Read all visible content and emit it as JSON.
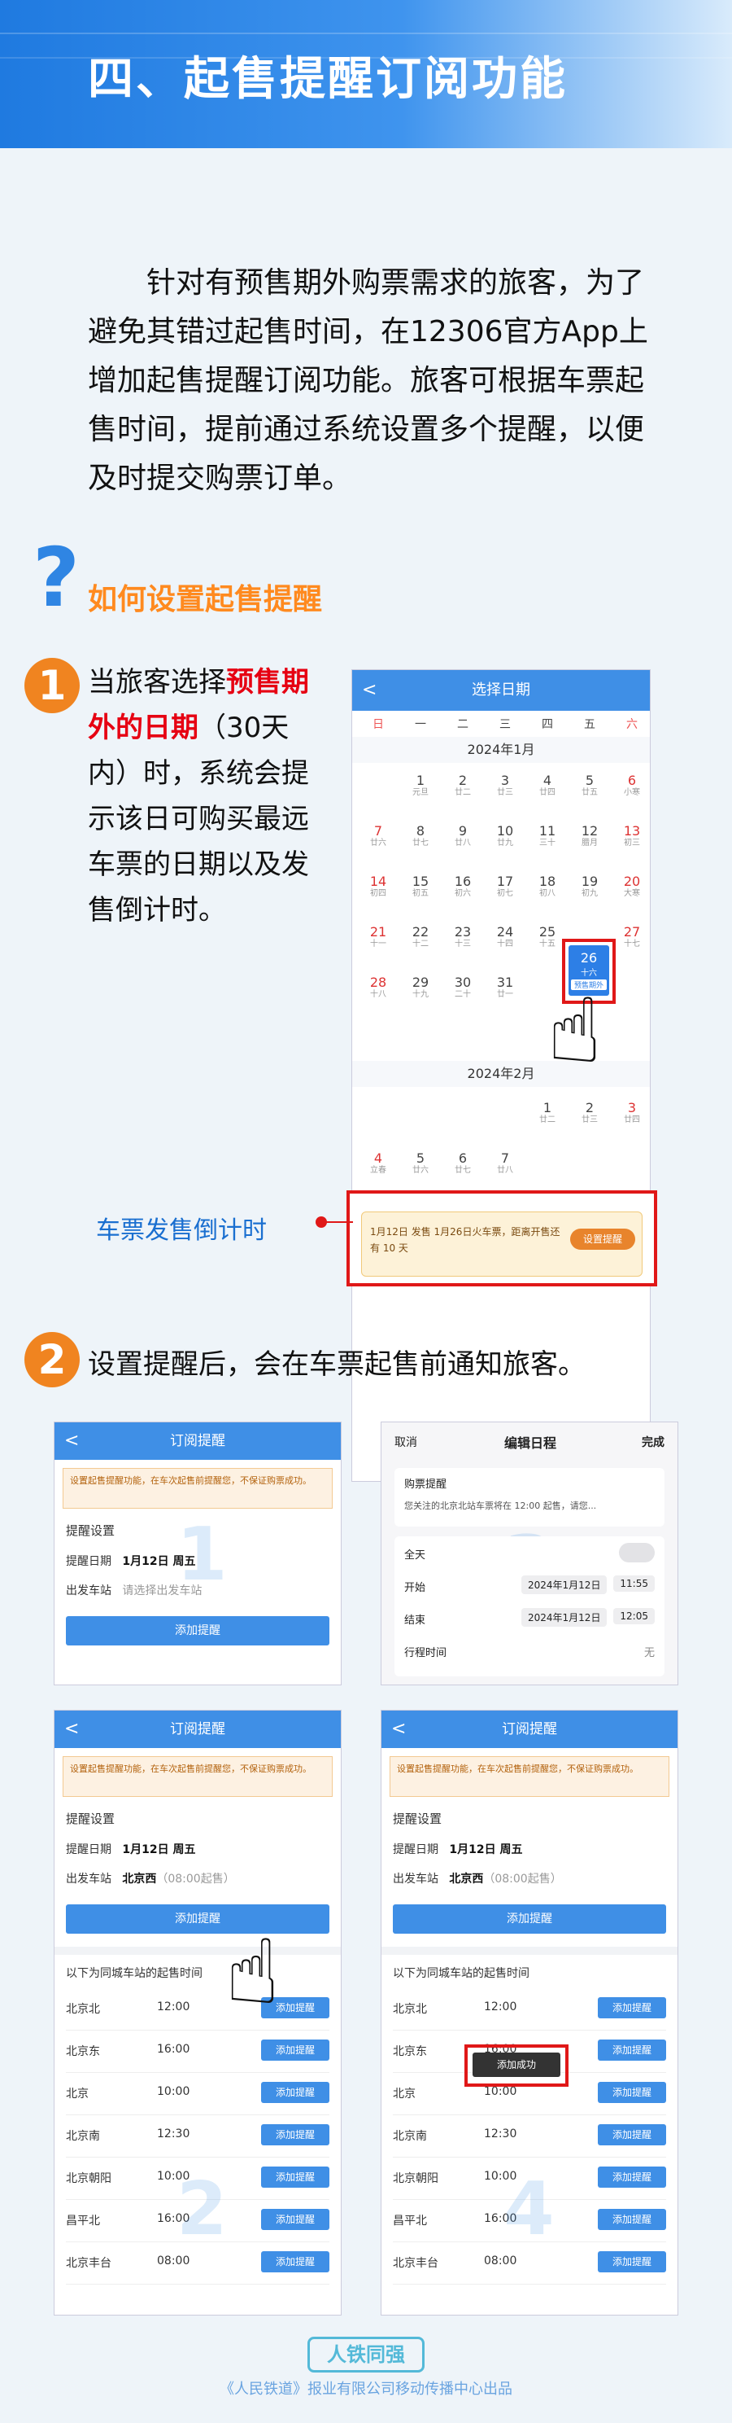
{
  "header": {
    "title": "四、起售提醒订阅功能"
  },
  "intro": {
    "text": "针对有预售期外购票需求的旅客，为了避免其错过起售时间，在12306官方App上增加起售提醒订阅功能。旅客可根据车票起售时间，提前通过系统设置多个提醒，以便及时提交购票订单。"
  },
  "question": {
    "mark": "?",
    "title": "如何设置起售提醒"
  },
  "step1": {
    "num": "1",
    "t1": "当旅客选择",
    "t2": "预售期外的日期",
    "t3": "（30天内）时，系统会提示该日可购买最远车票的日期以及发售倒计时。",
    "countdown_label": "车票发售倒计时"
  },
  "step2": {
    "num": "2",
    "text": "设置提醒后，会在车票起售前通知旅客。"
  },
  "phone1": {
    "title": "选择日期",
    "back": "<",
    "weekdays": [
      "日",
      "一",
      "二",
      "三",
      "四",
      "五",
      "六"
    ],
    "month1": "2024年1月",
    "month2": "2024年2月",
    "days1": [
      [
        "",
        "",
        ""
      ],
      [
        "1",
        "元旦",
        ""
      ],
      [
        "2",
        "廿二",
        ""
      ],
      [
        "3",
        "廿三",
        ""
      ],
      [
        "4",
        "廿四",
        ""
      ],
      [
        "5",
        "廿五",
        ""
      ],
      [
        "6",
        "小寒",
        ""
      ],
      [
        "7",
        "廿六",
        ""
      ],
      [
        "8",
        "廿七",
        ""
      ],
      [
        "9",
        "廿八",
        ""
      ],
      [
        "10",
        "廿九",
        ""
      ],
      [
        "11",
        "三十",
        ""
      ],
      [
        "12",
        "腊月",
        ""
      ],
      [
        "13",
        "初三",
        ""
      ],
      [
        "14",
        "初四",
        ""
      ],
      [
        "15",
        "初五",
        ""
      ],
      [
        "16",
        "初六",
        ""
      ],
      [
        "17",
        "初七",
        ""
      ],
      [
        "18",
        "初八",
        ""
      ],
      [
        "19",
        "初九",
        ""
      ],
      [
        "20",
        "大寒",
        ""
      ],
      [
        "21",
        "十一",
        ""
      ],
      [
        "22",
        "十二",
        ""
      ],
      [
        "23",
        "十三",
        ""
      ],
      [
        "24",
        "十四",
        ""
      ],
      [
        "25",
        "十五",
        ""
      ],
      [
        "26",
        "十六",
        ""
      ],
      [
        "27",
        "十七",
        ""
      ],
      [
        "28",
        "十八",
        ""
      ],
      [
        "29",
        "十九",
        ""
      ],
      [
        "30",
        "二十",
        ""
      ],
      [
        "31",
        "廿一",
        ""
      ]
    ],
    "sel_day": "26",
    "sel_sub": "十六",
    "sel_tag": "预售期外",
    "days2": [
      [
        "1",
        "廿二"
      ],
      [
        "2",
        "廿三"
      ],
      [
        "3",
        "廿四"
      ],
      [
        "4",
        "立春"
      ],
      [
        "5",
        "廿六"
      ],
      [
        "6",
        "廿七"
      ],
      [
        "7",
        "廿八"
      ]
    ],
    "banner_text": "1月12日 发售 1月26日火车票，距离开售还有 10 天",
    "banner_btn": "设置提醒"
  },
  "phoneA": {
    "title": "订阅提醒",
    "back": "<",
    "notice": "设置起售提醒功能，在车次起售前提醒您，不保证购票成功。",
    "num": "1",
    "section": "提醒设置",
    "r1_label": "提醒日期",
    "r1_val": "1月12日 周五",
    "r2_label": "出发车站",
    "r2_val": "请选择出发车站",
    "btn": "添加提醒"
  },
  "phoneB": {
    "cancel": "取消",
    "title": "编辑日程",
    "done": "完成",
    "num": "3",
    "item": "购票提醒",
    "desc": "您关注的北京北站车票将在 12:00 起售，请您...",
    "allday": "全天",
    "start": "开始",
    "start_date": "2024年1月12日",
    "start_time": "11:55",
    "end": "结束",
    "end_date": "2024年1月12日",
    "end_time": "12:05",
    "travel": "行程时间",
    "travel_val": "无"
  },
  "phoneC": {
    "title": "订阅提醒",
    "back": "<",
    "notice": "设置起售提醒功能，在车次起售前提醒您，不保证购票成功。",
    "num": "2",
    "section": "提醒设置",
    "r1_label": "提醒日期",
    "r1_val": "1月12日 周五",
    "r2_label": "出发车站",
    "r2_val": "北京西",
    "r2_sub": "（08:00起售）",
    "btn": "添加提醒",
    "list_title": "以下为同城车站的起售时间",
    "stations": [
      [
        "北京北",
        "12:00"
      ],
      [
        "北京东",
        "16:00"
      ],
      [
        "北京",
        "10:00"
      ],
      [
        "北京南",
        "12:30"
      ],
      [
        "北京朝阳",
        "10:00"
      ],
      [
        "昌平北",
        "16:00"
      ],
      [
        "北京丰台",
        "08:00"
      ]
    ],
    "add": "添加提醒"
  },
  "phoneD": {
    "title": "订阅提醒",
    "back": "<",
    "notice": "设置起售提醒功能，在车次起售前提醒您，不保证购票成功。",
    "num": "4",
    "section": "提醒设置",
    "r1_label": "提醒日期",
    "r1_val": "1月12日 周五",
    "r2_label": "出发车站",
    "r2_val": "北京西",
    "r2_sub": "（08:00起售）",
    "btn": "添加提醒",
    "list_title": "以下为同城车站的起售时间",
    "stations": [
      [
        "北京北",
        "12:00"
      ],
      [
        "北京东",
        "16:00"
      ],
      [
        "北京",
        "10:00"
      ],
      [
        "北京南",
        "12:30"
      ],
      [
        "北京朝阳",
        "10:00"
      ],
      [
        "昌平北",
        "16:00"
      ],
      [
        "北京丰台",
        "08:00"
      ]
    ],
    "add": "添加提醒",
    "toast": "添加成功"
  },
  "footer": {
    "logo": "人铁同强",
    "text": "《人民铁道》报业有限公司移动传播中心出品"
  }
}
